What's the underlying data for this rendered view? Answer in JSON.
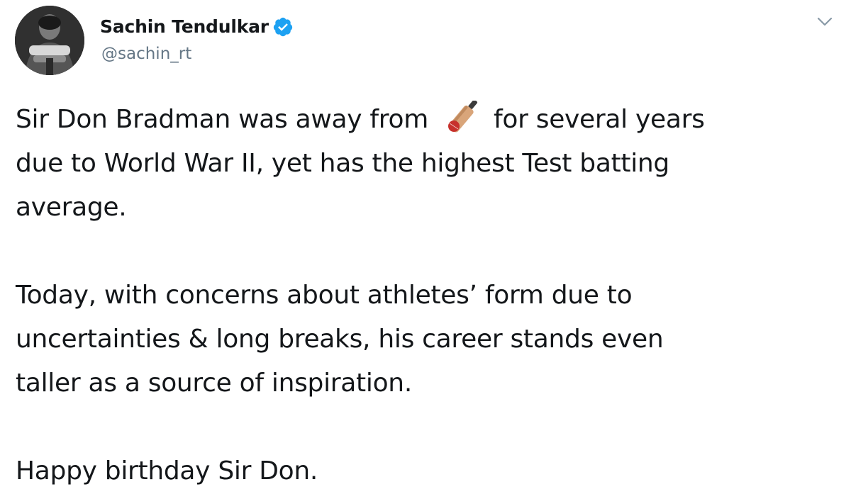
{
  "author": {
    "display_name": "Sachin Tendulkar",
    "handle": "@sachin_rt",
    "verified": true
  },
  "icons": {
    "verified": "verified-badge-icon",
    "menu": "chevron-down-icon",
    "emoji": "cricket-bat-ball-emoji"
  },
  "tweet": {
    "line1_pre": "Sir Don Bradman was away from",
    "line1_post": "for several years",
    "line2": "due to World War II, yet has the highest Test batting",
    "line3": "average.",
    "para2_line1": "Today, with concerns about athletes’ form due to",
    "para2_line2": "uncertainties & long breaks, his career stands even",
    "para2_line3": "taller as a source of inspiration.",
    "para3": "Happy birthday Sir Don."
  },
  "colors": {
    "text": "#14171a",
    "secondary": "#657786",
    "verified": "#1da1f2"
  }
}
